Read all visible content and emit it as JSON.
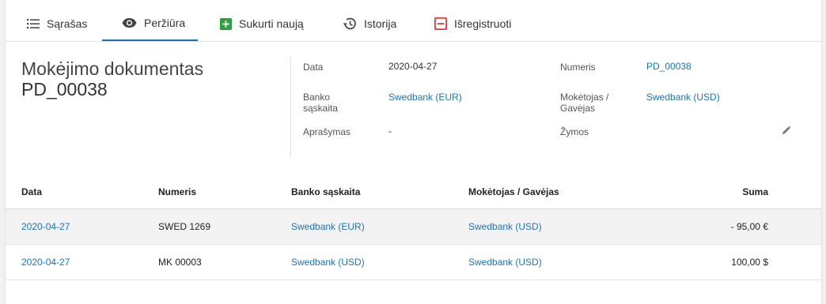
{
  "tabs": [
    {
      "label": "Sąrašas",
      "icon": "list-icon"
    },
    {
      "label": "Peržiūra",
      "icon": "eye-icon",
      "active": true
    },
    {
      "label": "Sukurti naują",
      "icon": "plus-square-icon"
    },
    {
      "label": "Istorija",
      "icon": "history-icon"
    },
    {
      "label": "Išregistruoti",
      "icon": "minus-square-icon"
    }
  ],
  "document": {
    "title": "Mokėjimo dokumentas",
    "number": "PD_00038"
  },
  "fields": {
    "date_label": "Data",
    "date_value": "2020-04-27",
    "number_label": "Numeris",
    "number_value": "PD_00038",
    "bank_label_1": "Banko",
    "bank_label_2": "sąskaita",
    "bank_value": "Swedbank (EUR)",
    "payer_label_1": "Mokėtojas /",
    "payer_label_2": "Gavėjas",
    "payer_value": "Swedbank (USD)",
    "desc_label": "Aprašymas",
    "desc_value": "-",
    "tags_label": "Žymos"
  },
  "table": {
    "headers": {
      "date": "Data",
      "number": "Numeris",
      "bank": "Banko sąskaita",
      "payer": "Mokėtojas / Gavėjas",
      "sum": "Suma"
    },
    "rows": [
      {
        "date": "2020-04-27",
        "number": "SWED 1269",
        "bank": "Swedbank (EUR)",
        "payer": "Swedbank (USD)",
        "sum": "- 95,00 €"
      },
      {
        "date": "2020-04-27",
        "number": "MK 00003",
        "bank": "Swedbank (USD)",
        "payer": "Swedbank (USD)",
        "sum": "100,00 $"
      }
    ]
  },
  "colors": {
    "link": "#1a73b8",
    "tab_active_underline": "#1a73b8",
    "create_icon": "#2e9e3e",
    "unregister_icon": "#e53935"
  }
}
